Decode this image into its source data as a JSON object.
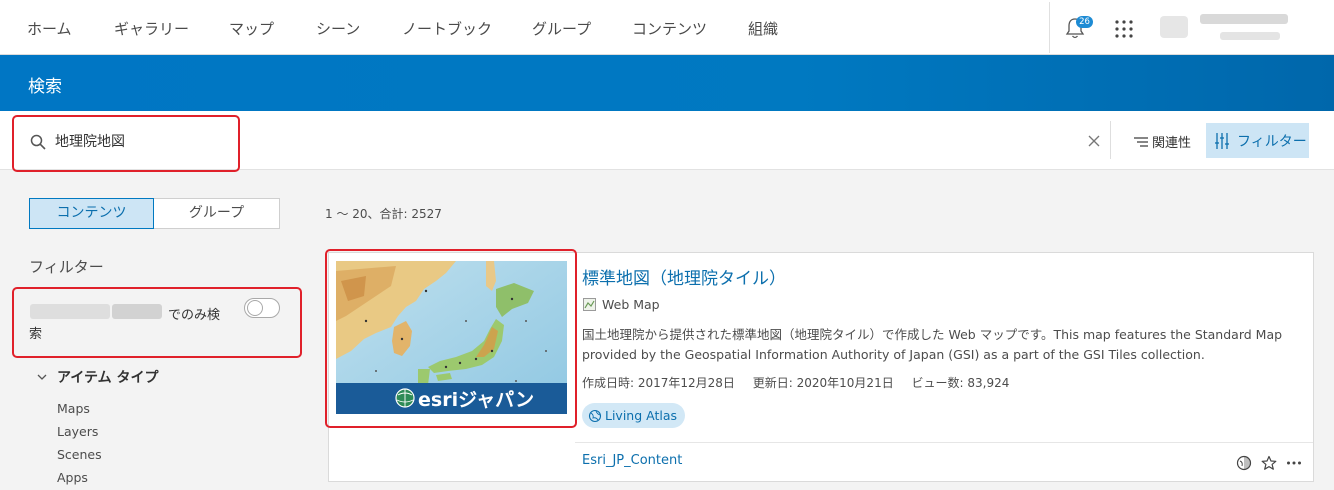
{
  "nav": {
    "items": [
      "ホーム",
      "ギャラリー",
      "マップ",
      "シーン",
      "ノートブック",
      "グループ",
      "コンテンツ",
      "組織"
    ],
    "notification_count": "26"
  },
  "header": {
    "title": "検索"
  },
  "search": {
    "query": "地理院地図"
  },
  "toolbar": {
    "sort_label": "関連性",
    "filter_label": "フィルター"
  },
  "left": {
    "segments": {
      "content": "コンテンツ",
      "groups": "グループ"
    },
    "filters_heading": "フィルター",
    "toggle_label_part1": "でのみ検",
    "toggle_label_part2": "索",
    "item_type_heading": "アイテム タイプ",
    "item_types": [
      "Maps",
      "Layers",
      "Scenes",
      "Apps"
    ]
  },
  "results": {
    "count_text": "1 ～ 20、合計: 2527",
    "items": [
      {
        "title": "標準地図（地理院タイル）",
        "type": "Web Map",
        "description": "国土地理院から提供された標準地図（地理院タイル）で作成した Web マップです。This map features the Standard Map provided by the Geospatial Information Authority of Japan (GSI) as a part of the GSI Tiles collection.",
        "created": "作成日時: 2017年12月28日",
        "updated": "更新日: 2020年10月21日",
        "views": "ビュー数: 83,924",
        "tag": "Living Atlas",
        "owner": "Esri_JP_Content",
        "thumbnail_caption": "esriジャパン"
      }
    ]
  },
  "colors": {
    "accent": "#0079c1",
    "highlight_box": "#e0202a",
    "selected_bg": "#cde5f5"
  },
  "icons": [
    "search-icon",
    "bell-icon",
    "apps-grid-icon",
    "close-icon",
    "sort-icon",
    "filter-icon",
    "chevron-down-icon",
    "web-map-icon",
    "globe-icon",
    "share-icon",
    "star-icon",
    "more-icon"
  ]
}
